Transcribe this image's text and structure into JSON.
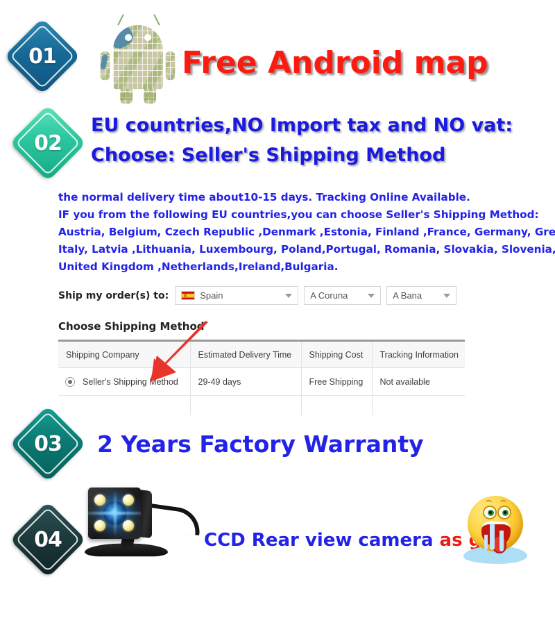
{
  "sections": [
    {
      "badge": "01",
      "badge_color": "#176a96",
      "headline": "Free Android map",
      "icon": "android-map-robot"
    },
    {
      "badge": "02",
      "badge_color": "#2ec9a0",
      "headline_line1": "EU countries,NO Import tax and NO vat:",
      "headline_line2": "Choose: Seller's Shipping Method"
    },
    {
      "badge": "03",
      "badge_color": "#0b7b74",
      "headline": "2 Years Factory Warranty"
    },
    {
      "badge": "04",
      "badge_color": "#1d3b3d",
      "headline_blue": "CCD Rear view camera",
      "headline_red": "as gift",
      "icon": "drooling-emoji"
    }
  ],
  "paragraph": {
    "line1": "the normal delivery time about10-15 days. Tracking Online Available.",
    "line2": "IF you from the following EU countries,you can choose Seller's Shipping Method:",
    "line3": "Austria, Belgium, Czech Republic ,Denmark ,Estonia, Finland ,France, Germany, Greece, Hungary,",
    "line4": "Italy, Latvia ,Lithuania, Luxembourg, Poland,Portugal, Romania, Slovakia, Slovenia, Spain, Sweden,",
    "line5": "United Kingdom ,Netherlands,Ireland,Bulgaria."
  },
  "ship_to": {
    "label": "Ship my order(s) to:",
    "country": "Spain",
    "country_flag": "spain-flag-icon",
    "province": "A Coruna",
    "city": "A Bana"
  },
  "shipping_table": {
    "title": "Choose Shipping Method",
    "columns": [
      "Shipping Company",
      "Estimated Delivery Time",
      "Shipping Cost",
      "Tracking Information"
    ],
    "rows": [
      {
        "selected": true,
        "company": "Seller's Shipping Method",
        "delivery_time": "29-49 days",
        "cost": "Free Shipping",
        "tracking": "Not available"
      }
    ]
  },
  "colors": {
    "headline_red": "#fc1b10",
    "headline_blue": "#2222e8",
    "arrow_red": "#e8342a"
  }
}
